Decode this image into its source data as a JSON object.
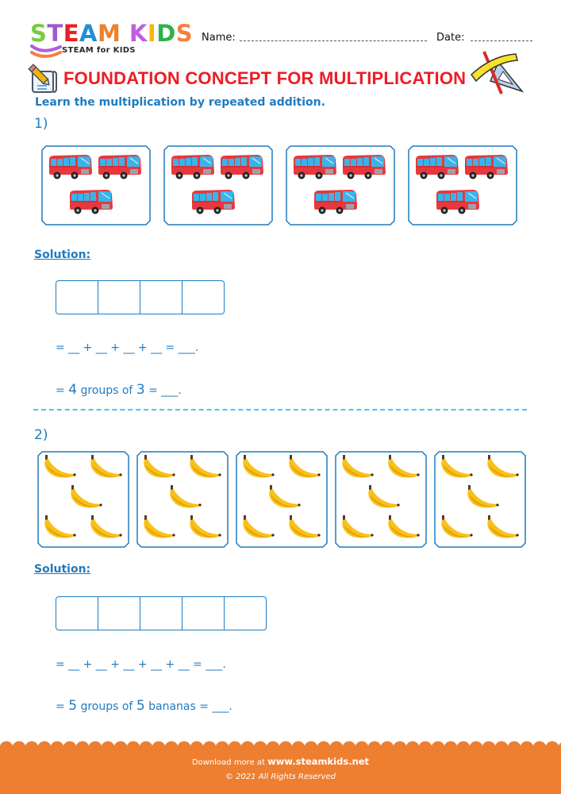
{
  "header": {
    "logo": {
      "letters": [
        {
          "char": "S",
          "color": "#7ac943"
        },
        {
          "char": "T",
          "color": "#9b59d0"
        },
        {
          "char": "E",
          "color": "#ee1c25"
        },
        {
          "char": "A",
          "color": "#1f8fd6"
        },
        {
          "char": "M",
          "color": "#f07f2c"
        },
        {
          "char": " ",
          "color": "#ffffff"
        },
        {
          "char": "K",
          "color": "#c05de0"
        },
        {
          "char": "I",
          "color": "#f5b800"
        },
        {
          "char": "D",
          "color": "#2db24a"
        },
        {
          "char": "S",
          "color": "#f4813f"
        }
      ],
      "tagline": "STEAM for KIDS"
    },
    "name_label": "Name:",
    "date_label": "Date:"
  },
  "title": "FOUNDATION CONCEPT FOR MULTIPLICATION",
  "subtitle": "Learn the multiplication by repeated addition.",
  "questions": [
    {
      "number": "1)",
      "item": "bus",
      "groups": 4,
      "items_per_group": 3,
      "solution_label": "Solution:",
      "answer_boxes": 4,
      "equation_repeated": "= __ + __ + __ + __ = ___.",
      "equation_groups": {
        "prefix": "= ",
        "n1": "4",
        "mid": " groups of ",
        "n2": "3",
        "suffix": " = ___."
      }
    },
    {
      "number": "2)",
      "item": "banana",
      "groups": 5,
      "items_per_group": 5,
      "solution_label": "Solution:",
      "answer_boxes": 5,
      "equation_repeated": "= __ + __ + __ + __ + __ = ___.",
      "equation_groups": {
        "prefix": "= ",
        "n1": "5",
        "mid": " groups of ",
        "n2": "5",
        "suffix": " bananas = ___."
      }
    }
  ],
  "footer": {
    "download_text": "Download more at ",
    "url": "www.steamkids.net",
    "copyright": "© 2021 All Rights Reserved"
  },
  "colors": {
    "title_red": "#ee1c25",
    "accent_blue": "#1f7bc1",
    "divider_blue": "#4fc3f0",
    "footer_orange": "#ee7f31",
    "bus_red": "#e8383d",
    "banana_yellow": "#f8c01a"
  }
}
